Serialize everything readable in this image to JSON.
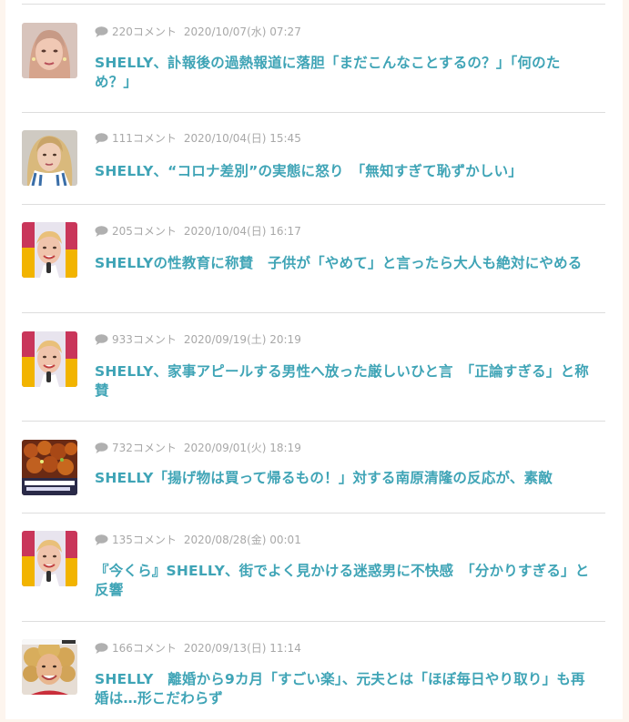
{
  "articles": [
    {
      "comments": "220コメント",
      "date": "2020/10/07(水) 07:27",
      "title": "SHELLY、訃報後の過熱報道に落胆「まだこんなことするの？」「何のため？」",
      "thumb": "woman-pale-bg"
    },
    {
      "comments": "111コメント",
      "date": "2020/10/04(日) 15:45",
      "title": "SHELLY、“コロナ差別”の実態に怒り　「無知すぎて恥ずかしい」",
      "thumb": "woman-blonde-striped-shirt"
    },
    {
      "comments": "205コメント",
      "date": "2020/10/04(日) 16:17",
      "title": "SHELLYの性教育に称賛　子供が「やめて」と言ったら大人も絶対にやめる",
      "thumb": "woman-colorful-bg"
    },
    {
      "comments": "933コメント",
      "date": "2020/09/19(土) 20:19",
      "title": "SHELLY、家事アピールする男性へ放った厳しいひと言　「正論すぎる」と称賛",
      "thumb": "woman-colorful-bg"
    },
    {
      "comments": "732コメント",
      "date": "2020/09/01(火) 18:19",
      "title": "SHELLY「揚げ物は買って帰るもの！」対する南原清隆の反応が、素敵",
      "thumb": "fried-food"
    },
    {
      "comments": "135コメント",
      "date": "2020/08/28(金) 00:01",
      "title": "『今くら』SHELLY、街でよく見かける迷惑男に不快感　「分かりすぎる」と反響",
      "thumb": "woman-colorful-bg"
    },
    {
      "comments": "166コメント",
      "date": "2020/09/13(日) 11:14",
      "title": "SHELLY　離婚から9カ月「すごい楽」、元夫とは「ほぼ毎日やり取り」も再婚は…形こだわらず",
      "thumb": "woman-curly-hair"
    }
  ],
  "colors": {
    "title": "#3fa4b6",
    "meta": "#a8a8a8",
    "divider": "#dddddd",
    "page_bg": "#fdf5ee"
  }
}
